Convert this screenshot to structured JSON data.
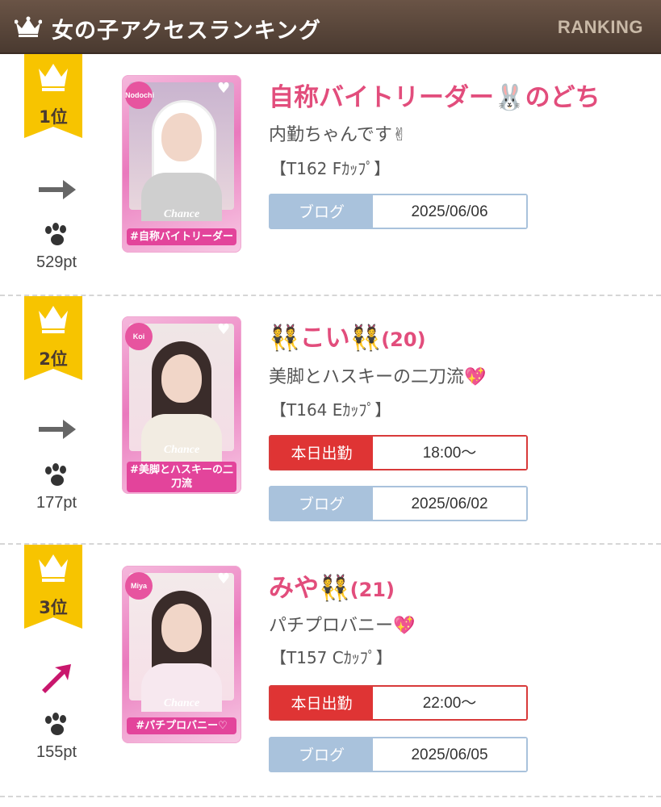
{
  "header": {
    "title": "女の子アクセスランキング",
    "subtitle": "RANKING",
    "crown_icon": "crown-icon"
  },
  "colors": {
    "header_bg": "#55433a",
    "rank_ribbon": "#f7c400",
    "name": "#e24d7c",
    "blog_button": "#a9c2dc",
    "work_button": "#df3434",
    "trend_up": "#c9176d",
    "trend_flat": "#666666"
  },
  "entries": [
    {
      "rank_label": "1位",
      "trend": "flat",
      "trend_icon": "right-arrow-icon",
      "points": "529pt",
      "photo": {
        "name_tag": "Nodochi",
        "brand": "Chance",
        "tagline": "#自称バイトリーダー"
      },
      "name": "自称バイトリーダー🐰のどち",
      "age": "",
      "catch": "内勤ちゃんです✌",
      "spec": "【T162 Fｶｯﾌﾟ】",
      "work": null,
      "blog": {
        "label": "ブログ",
        "date": "2025/06/06"
      }
    },
    {
      "rank_label": "2位",
      "trend": "flat",
      "trend_icon": "right-arrow-icon",
      "points": "177pt",
      "photo": {
        "name_tag": "Koi",
        "brand": "Chance",
        "tagline": "#美脚とハスキーの二刀流"
      },
      "name": "👯こい👯",
      "age": "(20)",
      "catch": "美脚とハスキーの二刀流💖",
      "spec": "【T164 Eｶｯﾌﾟ】",
      "work": {
        "label": "本日出勤",
        "time": "18:00〜"
      },
      "blog": {
        "label": "ブログ",
        "date": "2025/06/02"
      }
    },
    {
      "rank_label": "3位",
      "trend": "up",
      "trend_icon": "up-right-arrow-icon",
      "points": "155pt",
      "photo": {
        "name_tag": "Miya",
        "brand": "Chance",
        "tagline": "#パチプロバニー♡"
      },
      "name": "みや👯",
      "age": "(21)",
      "catch": "パチプロバニー💖",
      "spec": "【T157 Cｶｯﾌﾟ】",
      "work": {
        "label": "本日出勤",
        "time": "22:00〜"
      },
      "blog": {
        "label": "ブログ",
        "date": "2025/06/05"
      }
    }
  ]
}
